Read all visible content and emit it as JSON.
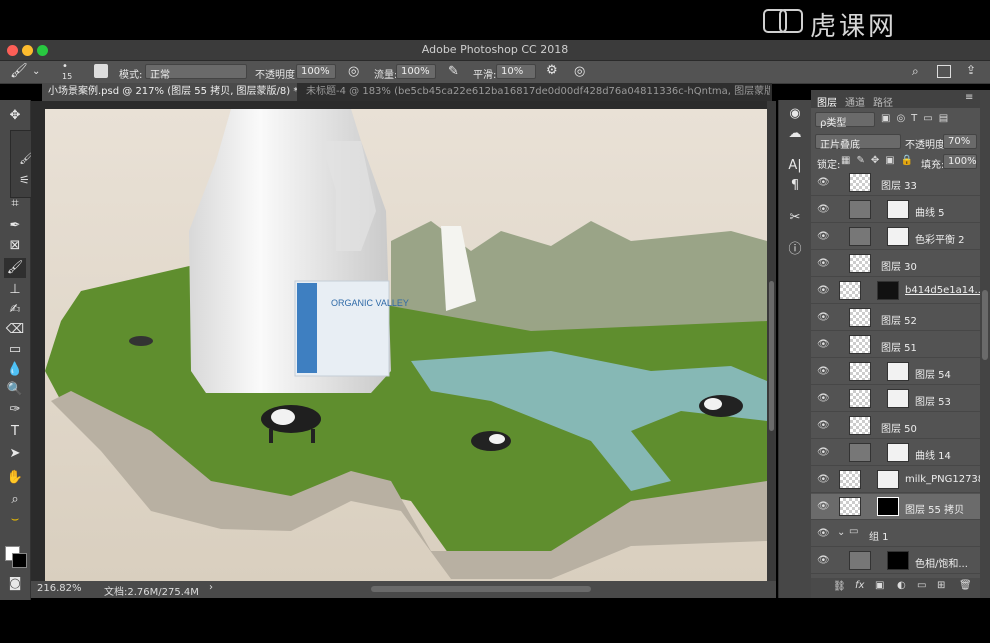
{
  "app": {
    "title": "Adobe Photoshop CC 2018"
  },
  "watermark": {
    "text": "虎课网"
  },
  "options_bar": {
    "brush_size": "15",
    "mode_label": "模式:",
    "mode_value": "正常",
    "opacity_label": "不透明度:",
    "opacity_value": "100%",
    "flow_label": "流量:",
    "flow_value": "100%",
    "smooth_label": "平滑:",
    "smooth_value": "10%"
  },
  "tabs": [
    {
      "label": "小场景案例.psd @ 217% (图层 55 拷贝, 图层蒙版/8) *",
      "close": "×"
    },
    {
      "label": "未标题-4 @ 183% (be5cb45ca22e612ba16817de0d00df428d76a04811336c-hQntma, 图层蒙版...",
      "close": "×"
    }
  ],
  "status": {
    "zoom": "216.82%",
    "doc": "文档:2.76M/275.4M",
    "arrow": "›"
  },
  "layers_panel": {
    "tabs": [
      "图层",
      "通道",
      "路径"
    ],
    "filter_label": "ρ类型",
    "blend_mode": "正片叠底",
    "opacity_label": "不透明度:",
    "opacity_value": "70%",
    "lock_label": "锁定:",
    "fill_label": "填充:",
    "fill_value": "100%",
    "layers": [
      {
        "name": "图层 33"
      },
      {
        "name": "曲线 5"
      },
      {
        "name": "色彩平衡 2"
      },
      {
        "name": "图层 30"
      },
      {
        "name": "b414d5e1a14..."
      },
      {
        "name": "图层 52"
      },
      {
        "name": "图层 51"
      },
      {
        "name": "图层 54"
      },
      {
        "name": "图层 53"
      },
      {
        "name": "图层 50"
      },
      {
        "name": "曲线 14"
      },
      {
        "name": "milk_PNG12738"
      },
      {
        "name": "图层 55 拷贝"
      },
      {
        "name": "组 1"
      },
      {
        "name": "色相/饱和..."
      }
    ]
  },
  "canvas": {
    "product_brand": "ORGANIC VALLEY",
    "colors": {
      "sky": "#e6ddd0",
      "grass": "#5e8f2f",
      "water": "#7db3b1",
      "rock": "#b7b0a3"
    }
  }
}
